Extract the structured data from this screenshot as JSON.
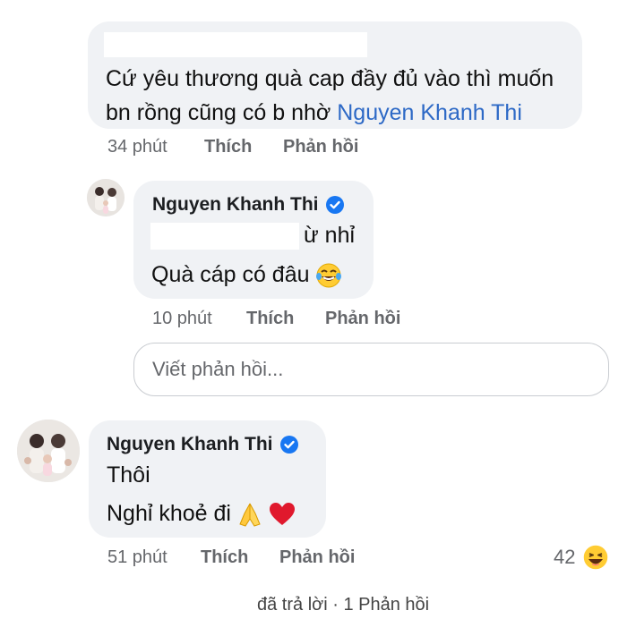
{
  "comment1": {
    "line1": "Cứ yêu thương quà cap đầy đủ vào thì muốn",
    "line2_prefix": "bn rồng cũng có b nhờ ",
    "mention": "Nguyen Khanh Thi",
    "time": "34 phút",
    "like": "Thích",
    "reply": "Phản hồi"
  },
  "reply1": {
    "author": "Nguyen Khanh Thi",
    "line1_suffix": "ừ nhỉ",
    "line2": "Quà cáp có đâu",
    "line2_emoji": "laughing-tears-emoji",
    "time": "10 phút",
    "like": "Thích",
    "reply": "Phản hồi"
  },
  "reply_input": {
    "placeholder": "Viết phản hồi..."
  },
  "comment2": {
    "author": "Nguyen Khanh Thi",
    "line1": "Thôi",
    "line2": "Nghỉ khoẻ đi",
    "line2_emojis": [
      "folded-hands-emoji",
      "red-heart-emoji"
    ],
    "time": "51 phút",
    "like": "Thích",
    "reply": "Phản hồi",
    "reaction_count": "42",
    "reaction_icon": "haha-reaction-icon"
  },
  "footer": {
    "replied_text": "đã trả lời · 1 Phản hồi"
  },
  "colors": {
    "bubble": "#f0f2f5",
    "mention": "#2d69c6",
    "verified": "#1877f2",
    "meta": "#65676b"
  }
}
